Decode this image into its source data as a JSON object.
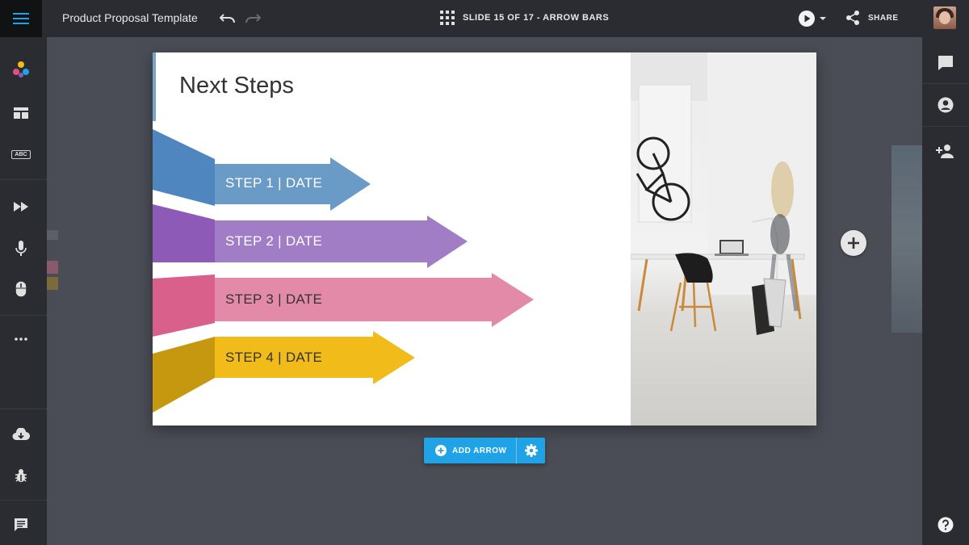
{
  "header": {
    "doc_title": "Product Proposal Template",
    "slide_indicator": "SLIDE 15 OF 17 - ARROW BARS",
    "share_label": "SHARE"
  },
  "left_sidebar": {
    "icons": [
      "menu-icon",
      "palette-icon",
      "layout-icon",
      "text-icon",
      "animation-icon",
      "microphone-icon",
      "mouse-icon",
      "more-icon",
      "download-icon",
      "bug-icon",
      "feedback-icon"
    ],
    "text_button_label": "ABC"
  },
  "right_sidebar": {
    "icons": [
      "comment-icon",
      "account-icon",
      "add-user-icon",
      "help-icon"
    ]
  },
  "slide": {
    "title": "Next Steps",
    "arrows": [
      {
        "label": "STEP 1 | DATE",
        "color": "#6a9ac6",
        "tail_color": "#4f86bf"
      },
      {
        "label": "STEP 2 | DATE",
        "color": "#a07dc4",
        "tail_color": "#8e5ab8"
      },
      {
        "label": "STEP 3 | DATE",
        "color": "#e38aa8",
        "tail_color": "#d8608b"
      },
      {
        "label": "STEP 4 | DATE",
        "color": "#f1bb19",
        "tail_color": "#c6980f"
      }
    ]
  },
  "toolbar": {
    "add_arrow_label": "ADD ARROW"
  },
  "colors": {
    "accent": "#1fa3e6",
    "chrome": "#2b2c31",
    "canvas": "#4a4d55"
  }
}
